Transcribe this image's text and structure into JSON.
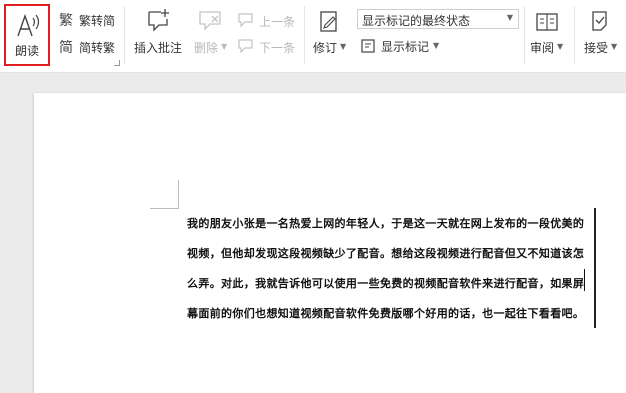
{
  "ribbon": {
    "read_aloud": "朗读",
    "to_traditional": "繁转简",
    "to_simplified": "简转繁",
    "insert_comment": "插入批注",
    "delete": "删除",
    "previous": "上一条",
    "next": "下一条",
    "revise": "修订",
    "markup_mode": "显示标记的最终状态",
    "show_markup": "显示标记",
    "review": "审阅",
    "accept": "接受"
  },
  "document": {
    "lines": [
      "我的朋友小张是一名热爱上网的年轻人，于是这一天就在网上发布的一段优美的",
      "视频，但他却发现这段视频缺少了配音。想给这段视频进行配音但又不知道该怎",
      "么弄。对此，我就告诉他可以使用一些免费的视频配音软件来进行配音，如果屏",
      "幕面前的你们也想知道视频配音软件免费版哪个好用的话，也一起往下看看吧。"
    ]
  },
  "colors": {
    "highlight_border": "#e02020",
    "doc_background": "#ebebeb",
    "page": "#ffffff"
  }
}
